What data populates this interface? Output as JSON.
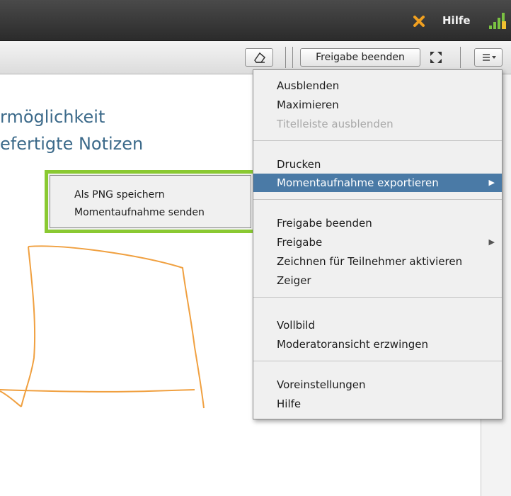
{
  "topbar": {
    "help_label": "Hilfe",
    "icons": [
      "x-icon",
      "signal-icon"
    ],
    "x_color": "#f0a020",
    "signal_color": "#7ac142"
  },
  "toolbar": {
    "stop_sharing_label": "Freigabe beenden",
    "icons": [
      "eraser-icon",
      "expand-icon",
      "menu-icon"
    ]
  },
  "canvas": {
    "text_line1": "rmöglichkeit",
    "text_line2": "efertigte Notizen",
    "text_color": "#3c6a8a",
    "drawing_color": "#f0a040"
  },
  "menu": {
    "group1": [
      "Ausblenden",
      "Maximieren",
      "Titelleiste ausblenden"
    ],
    "group2": [
      "Drucken",
      "Momentaufnahme exportieren"
    ],
    "group3": [
      "Freigabe beenden",
      "Freigabe",
      "Zeichnen für Teilnehmer aktivieren",
      "Zeiger"
    ],
    "group4": [
      "Vollbild",
      "Moderatoransicht erzwingen"
    ],
    "group5": [
      "Voreinstellungen",
      "Hilfe"
    ],
    "highlight_color": "#4a7aa6"
  },
  "submenu": {
    "items": [
      "Als PNG speichern",
      "Momentaufnahme senden"
    ],
    "frame_color": "#8ac932"
  }
}
